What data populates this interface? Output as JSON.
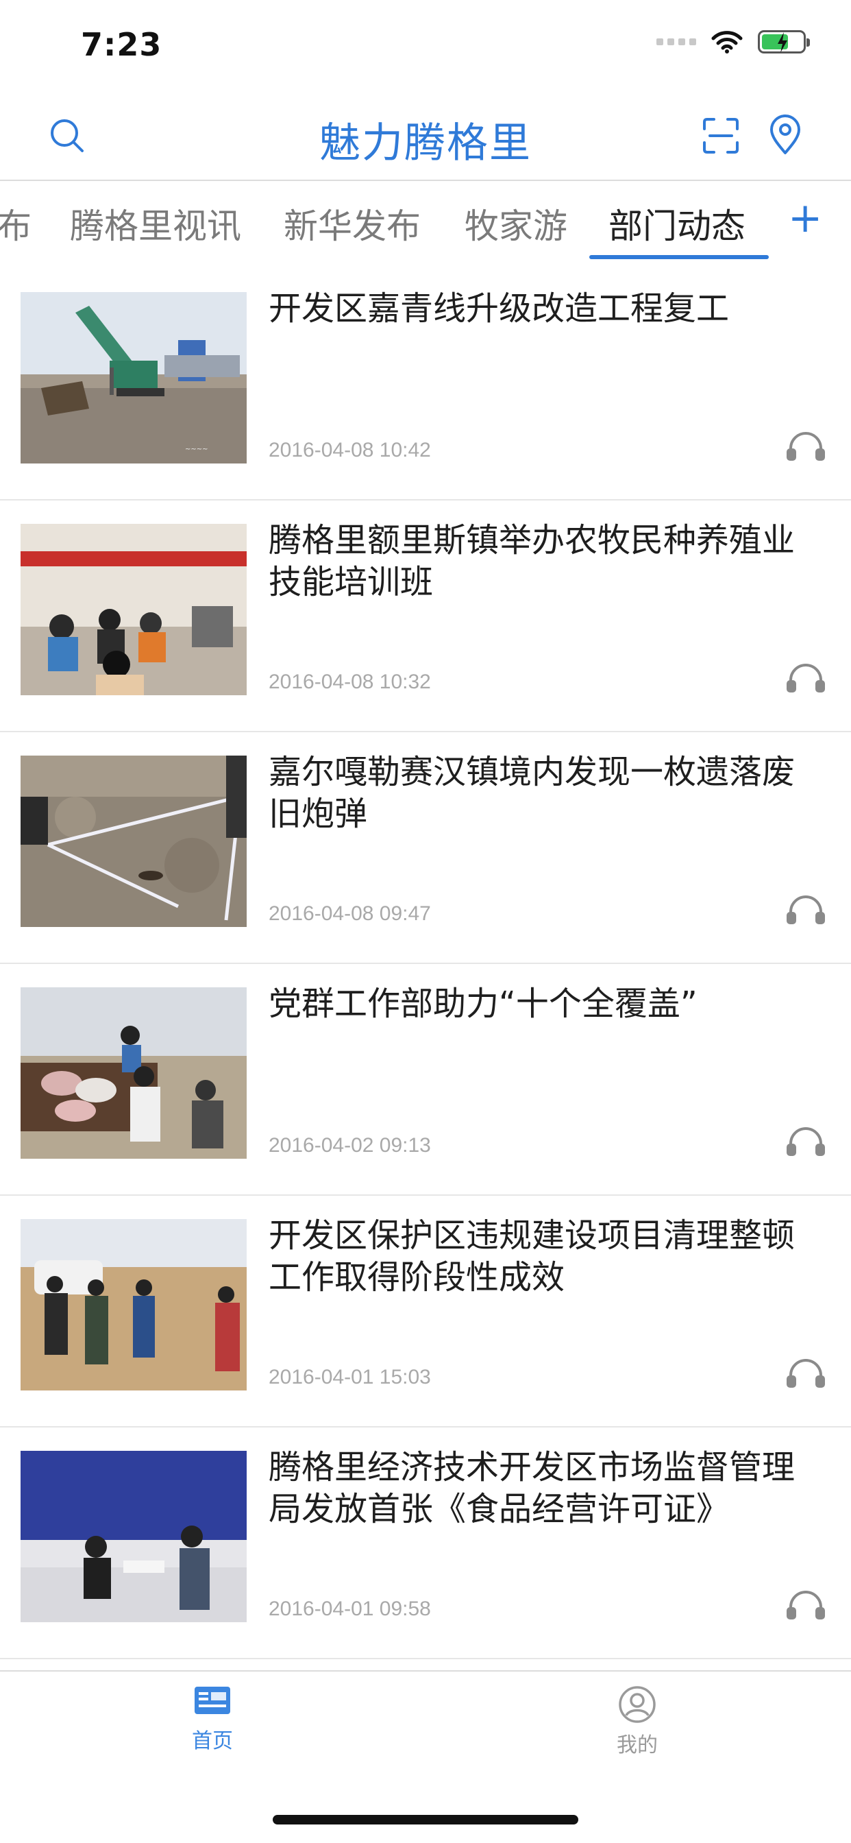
{
  "status_bar": {
    "time": "7:23"
  },
  "header": {
    "title": "魅力腾格里",
    "accent": "#2f7ad8"
  },
  "tabs": [
    {
      "label": "布"
    },
    {
      "label": "腾格里视讯"
    },
    {
      "label": "新华发布"
    },
    {
      "label": "牧家游"
    },
    {
      "label": "部门动态",
      "active": true
    }
  ],
  "tab_add": "+",
  "news": [
    {
      "title": "开发区嘉青线升级改造工程复工",
      "date": "2016-04-08 10:42"
    },
    {
      "title": "腾格里额里斯镇举办农牧民种养殖业技能培训班",
      "date": "2016-04-08 10:32"
    },
    {
      "title": "嘉尔嘎勒赛汉镇境内发现一枚遗落废旧炮弹",
      "date": "2016-04-08 09:47"
    },
    {
      "title": "党群工作部助力“十个全覆盖”",
      "date": "2016-04-02 09:13"
    },
    {
      "title": "开发区保护区违规建设项目清理整顿工作取得阶段性成效",
      "date": "2016-04-01 15:03"
    },
    {
      "title": "腾格里经济技术开发区市场监督管理局发放首张《食品经营许可证》",
      "date": "2016-04-01 09:58"
    }
  ],
  "tabbar": {
    "home": "首页",
    "mine": "我的",
    "active_color": "#3b86e0",
    "inactive_color": "#9a9a9a"
  },
  "icons": {
    "search": "search-icon",
    "scan": "scan-icon",
    "location": "location-icon",
    "listen": "headphones-icon",
    "home": "news-icon",
    "mine": "user-icon"
  }
}
